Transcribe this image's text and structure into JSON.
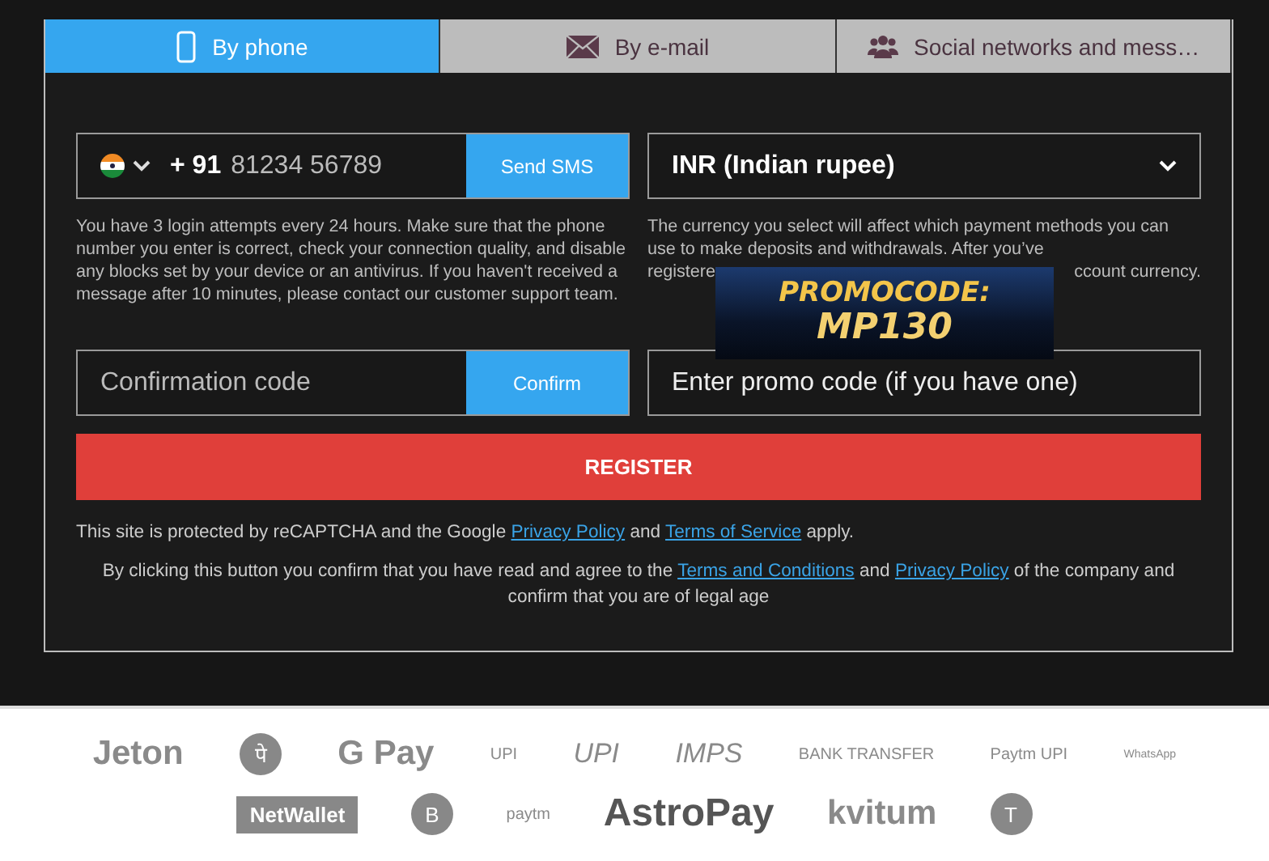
{
  "tabs": [
    {
      "kind": "phone",
      "label": "By phone",
      "selected": true
    },
    {
      "kind": "mail",
      "label": "By e-mail",
      "selected": false
    },
    {
      "kind": "people",
      "label": "Social networks and mess…",
      "selected": false
    }
  ],
  "phone": {
    "code": "+ 91",
    "placeholder": "81234 56789",
    "button": "Send SMS",
    "note": "You have 3 login attempts every 24 hours. Make sure that the phone number you enter is correct, check your connection quality, and disable any blocks set by your device or an antivirus. If you haven't received a message after 10 minutes, please contact our customer support team."
  },
  "currency": {
    "value": "INR (Indian rupee)",
    "note": "The currency you select will affect which payment methods you can use to make deposits and withdrawals. After you’ve",
    "note_cut_start": "registere",
    "note_cut_end": "ccount currency."
  },
  "confirmation": {
    "placeholder": "Confirmation code",
    "button": "Confirm"
  },
  "promo": {
    "placeholder": "Enter promo code (if you have one)"
  },
  "register_button": "REGISTER",
  "recaptcha": [
    {
      "text": "This site is protected by reCAPTCHA and the Google",
      "link": false
    },
    {
      "text": "Privacy Policy",
      "link": true
    },
    {
      "text": "and",
      "link": false
    },
    {
      "text": "Terms of Service",
      "link": true
    },
    {
      "text": "apply.",
      "link": false
    }
  ],
  "consent": [
    {
      "text": "By clicking this button you confirm that you have read and agree to the",
      "link": false
    },
    {
      "text": "Terms and Conditions",
      "link": true
    },
    {
      "text": "and",
      "link": false
    },
    {
      "text": "Privacy Policy",
      "link": true
    },
    {
      "text": "of the company and confirm that you are of legal age",
      "link": false
    }
  ],
  "banner": {
    "line_1": "PROMOCODE:",
    "line_2": "MP130"
  },
  "payment_rows": [
    [
      {
        "kind": "word",
        "text": "Jeton"
      },
      {
        "kind": "circle",
        "text": "पे"
      },
      {
        "kind": "word",
        "text": "G Pay"
      },
      {
        "kind": "small",
        "text": "UPI"
      },
      {
        "kind": "italic",
        "text": "UPI"
      },
      {
        "kind": "italic",
        "text": "IMPS"
      },
      {
        "kind": "small",
        "text": "BANK TRANSFER"
      },
      {
        "kind": "small",
        "text": "Paytm UPI"
      },
      {
        "kind": "dot",
        "text": "WhatsApp"
      }
    ],
    [
      {
        "kind": "box",
        "text": "NetWallet"
      },
      {
        "kind": "circle",
        "text": "B"
      },
      {
        "kind": "small",
        "text": "paytm"
      },
      {
        "kind": "bold",
        "text": "AstroPay"
      },
      {
        "kind": "word",
        "text": "kvitum"
      },
      {
        "kind": "circle",
        "text": "T"
      }
    ]
  ]
}
